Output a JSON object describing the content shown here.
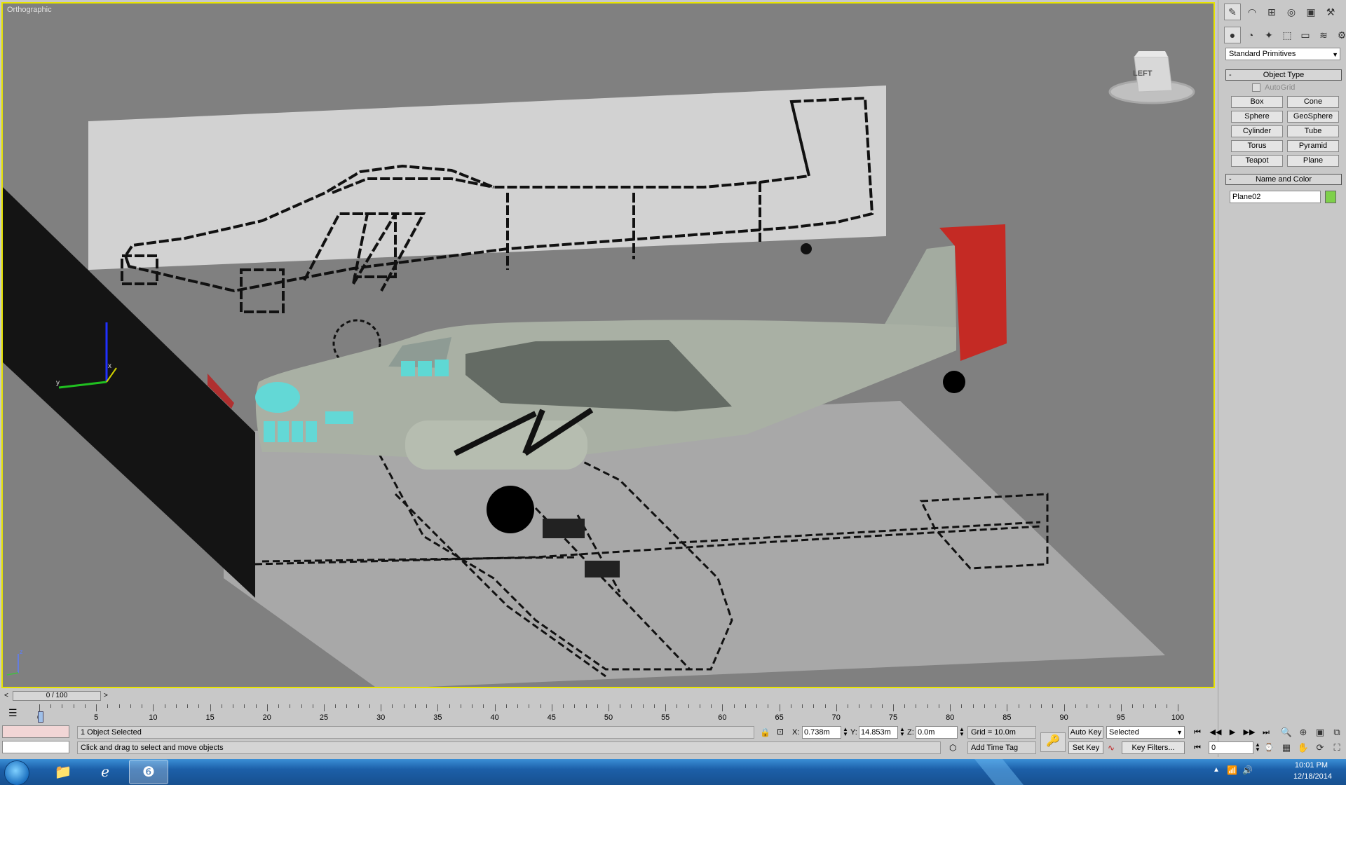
{
  "viewport": {
    "label": "Orthographic",
    "viewcube_label": "LEFT"
  },
  "command_panel": {
    "tabs": [
      "create-tab",
      "modify-tab",
      "hierarchy-tab",
      "motion-tab",
      "display-tab",
      "utilities-tab"
    ],
    "subtabs": [
      "geometry",
      "shapes",
      "lights",
      "cameras",
      "helpers",
      "space-warps",
      "systems"
    ],
    "category": "Standard Primitives",
    "object_type": {
      "title": "Object Type",
      "autogrid": "AutoGrid",
      "buttons": [
        "Box",
        "Cone",
        "Sphere",
        "GeoSphere",
        "Cylinder",
        "Tube",
        "Torus",
        "Pyramid",
        "Teapot",
        "Plane"
      ]
    },
    "name_and_color": {
      "title": "Name and Color",
      "name": "Plane02",
      "color": "#7ed04a"
    }
  },
  "time_slider": {
    "label": "0 / 100",
    "prev": "<",
    "next": ">"
  },
  "trackbar": {
    "ticks": [
      "0",
      "5",
      "10",
      "15",
      "20",
      "25",
      "30",
      "35",
      "40",
      "45",
      "50",
      "55",
      "60",
      "65",
      "70",
      "75",
      "80",
      "85",
      "90",
      "95",
      "100"
    ]
  },
  "status": {
    "selection": "1 Object Selected",
    "prompt": "Click and drag to select and move objects",
    "x_label": "X:",
    "x": "0.738m",
    "y_label": "Y:",
    "y": "14.853m",
    "z_label": "Z:",
    "z": "0.0m",
    "grid": "Grid = 10.0m",
    "add_time_tag": "Add Time Tag",
    "auto_key": "Auto Key",
    "set_key": "Set Key",
    "selection_set": "Selected",
    "key_filters": "Key Filters...",
    "frame": "0"
  },
  "taskbar": {
    "time": "10:01 PM",
    "date": "12/18/2014"
  }
}
